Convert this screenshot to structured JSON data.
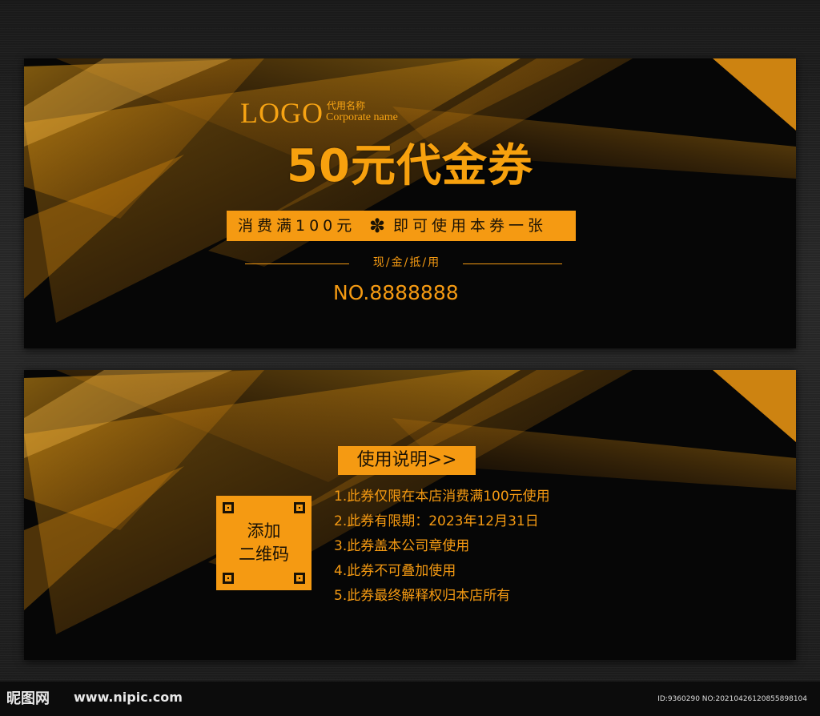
{
  "front": {
    "logo_mark": "LOGO",
    "logo_name_cn": "代用名称",
    "logo_name_en": "Corporate name",
    "title": "50元代金券",
    "condition_left": "消费满100元",
    "condition_right": "即可使用本券一张",
    "subtitle": "现/金/抵/用",
    "serial": "NO.8888888"
  },
  "back": {
    "instructions_title": "使用说明>>",
    "rules": [
      "1.此券仅限在本店消费满100元使用",
      "2.此券有限期：2023年12月31日",
      "3.此券盖本公司章使用",
      "4.此券不可叠加使用",
      "5.此券最终解释权归本店所有"
    ],
    "qr_line1": "添加",
    "qr_line2": "二维码"
  },
  "watermark": {
    "brand": "昵图网",
    "url": "www.nipic.com",
    "id": "ID:9360290 NO:20210426120855898104"
  },
  "colors": {
    "accent": "#f59a12",
    "card_bg": "#060606",
    "page_bg": "#222222"
  }
}
